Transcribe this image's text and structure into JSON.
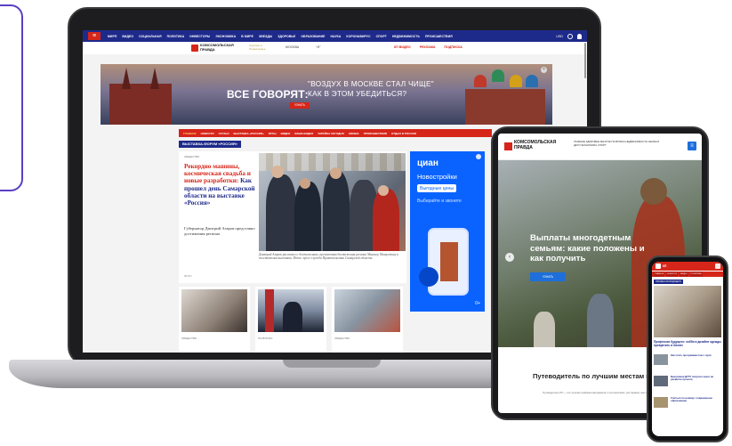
{
  "laptop": {
    "topnav": {
      "items": [
        "МИРП",
        "ВИДЕО",
        "СОЦИАЛЬНАЯ",
        "ПОЛИТИКА",
        "ИНВЕСТОРЫ",
        "ЭКОНОМИКА",
        "В МИРЕ",
        "ЗВЕЗДЫ",
        "ЗДОРОВЬЕ",
        "ОБРАЗОВАНИЕ",
        "НАУКА",
        "КОРОНАВИРУС",
        "СПОРТ",
        "НЕДВИЖИМОСТЬ",
        "ПРОИСШЕСТВИЯ"
      ],
      "currency": "USD",
      "menu_glyph": "≡"
    },
    "logo": {
      "text": "КОМСОМОЛЬСКАЯ ПРАВДА",
      "sub": "Сделано в Подмосковье",
      "city": "МОСКВА",
      "weather": "+5°",
      "links": [
        "КП ВИДЕО",
        "РЕКЛАМА",
        "ПОДПИСКА"
      ]
    },
    "banner": {
      "left": "ВСЕ ГОВОРЯТ:",
      "right_line1": "\"ВОЗДУХ В МОСКВЕ СТАЛ ЧИЩЕ\"",
      "right_line2": "КАК В ЭТОМ УБЕДИТЬСЯ?",
      "button": "УЗНАТЬ",
      "close": "×"
    },
    "section_nav": [
      "ГЛАВНОЕ",
      "НОВОСТИ",
      "СТАТЬИ",
      "ВЫСТАВКА «РОССИЯ»",
      "ИГРЫ",
      "ВИДЕО",
      "ВАШЕ ВИДЕО",
      "УКРАЙНА СЕГОДНЯ",
      "АФИША",
      "ПРОИСШЕСТВИЯ",
      "ОТДЫХ В РОССИИ"
    ],
    "forum_tag": "ВЫСТАВКА-ФОРУМ «РОССИЯ»",
    "article": {
      "tag": "ОБЩЕСТВО",
      "title_accent": "Рекордно машины, космическая свадьба и новые разработки:",
      "title_rest": "Как прошел день Самарской области на выставке «Россия»",
      "desc": "Губернатор Дмитрий Азаров представил достижения региона",
      "author": "ФОТО",
      "caption": "Дмитрий Азаров рассказал о достижениях, презентовав достижения региона Михаилу Мишустину и посетителям выставки. Фото: пресс-служба Правительства Самарской области"
    },
    "mini_cards": [
      {
        "tag": "ОБЩЕСТВО"
      },
      {
        "tag": "ПОЛИТИКА"
      },
      {
        "tag": "ОБЩЕСТВО"
      }
    ],
    "cian": {
      "logo": "циан",
      "line1": "Новостройки",
      "pill": "Выгодные цены",
      "line2": "Выбирайте и звоните",
      "disclaimer": "0+"
    }
  },
  "tablet": {
    "logo": "КОМСОМОЛЬСКАЯ ПРАВДА",
    "links": "ГЛАВНОЕ  ЗДОРОВЬЕ  МНОГОЕ  ПОЛИТИКА  НЕДВИЖИМОСТЬ  СЕМЬЯ И ДЕТИ  ЭКОНОМИКА  СПОРТ",
    "burger": "≡",
    "hero_title": "Выплаты многодетным семьям: какие положены и как получить",
    "hero_button": "УЗНАТЬ",
    "arrow": "‹",
    "guide_title": "Путеводитель по лучшим местам и событиям",
    "guide_text": "Путеводитель КП — это лучшая подборка материалов о путешествиях, ресторанах, выставках и событиях города."
  },
  "phone": {
    "logo": "КП",
    "tabs": [
      "ГЛАВНОЕ",
      "НОВОСТИ",
      "ВИДЕО",
      "ПОЛИТИКА"
    ],
    "tag": "ПРОФЕССИИ БУДУЩЕГО",
    "headline": "Профессии будущего: хобби в дизайне одежды превратить в бизнес",
    "items": [
      "Как стать программистом с нуля",
      "Выпускник ДГТУ получил грант на развитие проекта",
      "Учиться по-новому: современное образование"
    ]
  },
  "colors": {
    "brand_blue": "#1e2a8a",
    "brand_red": "#d6261a",
    "cian_blue": "#0a63ff",
    "accent_purple": "#5a3fc4"
  }
}
